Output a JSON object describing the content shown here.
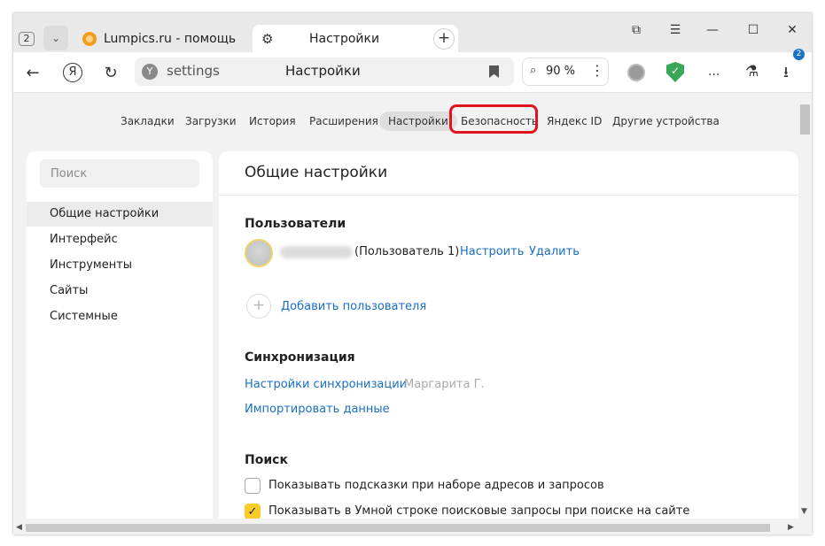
{
  "titlebar": {
    "tab_count": "2",
    "tabs": [
      {
        "title": "Lumpics.ru - помощь с компьютером",
        "icon": "orange-favicon",
        "active": false
      },
      {
        "title": "Настройки",
        "icon": "gear-icon",
        "active": true
      }
    ],
    "close_glyph": "✕",
    "new_tab_glyph": "+",
    "window_controls": {
      "minimize": "—",
      "maximize": "☐",
      "close": "✕",
      "menu": "☰",
      "pin": "⧉"
    }
  },
  "navbar": {
    "back": "←",
    "yandex_button": "Я",
    "reload": "↻",
    "omnibox_url": "settings",
    "omnibox_title": "Настройки",
    "zoom": "90 %",
    "zoom_icon": "⌕",
    "menu_dots": "⋮",
    "shield_glyph": "✓",
    "more": "...",
    "extensions_icon": "⚗",
    "downloads_icon": "⭳",
    "downloads_badge": "2"
  },
  "settings_nav": {
    "items": [
      "Закладки",
      "Загрузки",
      "История",
      "Расширения",
      "Настройки",
      "Безопасность",
      "Яндекс ID",
      "Другие устройства"
    ],
    "active": "Настройки",
    "highlighted": "Безопасность"
  },
  "sidebar": {
    "search_placeholder": "Поиск",
    "items": [
      "Общие настройки",
      "Интерфейс",
      "Инструменты",
      "Сайты",
      "Системные"
    ],
    "active": "Общие настройки"
  },
  "main": {
    "title": "Общие настройки",
    "users": {
      "heading": "Пользователи",
      "user_role": "(Пользователь 1)",
      "configure": "Настроить",
      "delete": "Удалить",
      "add_user": "Добавить пользователя",
      "add_glyph": "+"
    },
    "sync": {
      "heading": "Синхронизация",
      "settings_link": "Настройки синхронизации",
      "user_name": "Маргарита Г.",
      "import_link": "Импортировать данные"
    },
    "search": {
      "heading": "Поиск",
      "options": [
        {
          "label": "Показывать подсказки при наборе адресов и запросов",
          "checked": false
        },
        {
          "label": "Показывать в Умной строке поисковые запросы при поиске на сайте",
          "checked": true
        }
      ],
      "check_glyph": "✓"
    }
  },
  "colors": {
    "accent_link": "#1a6fc4",
    "highlight": "#e0141e",
    "checkbox_on": "#f9cc2b",
    "shield": "#3aa657"
  }
}
